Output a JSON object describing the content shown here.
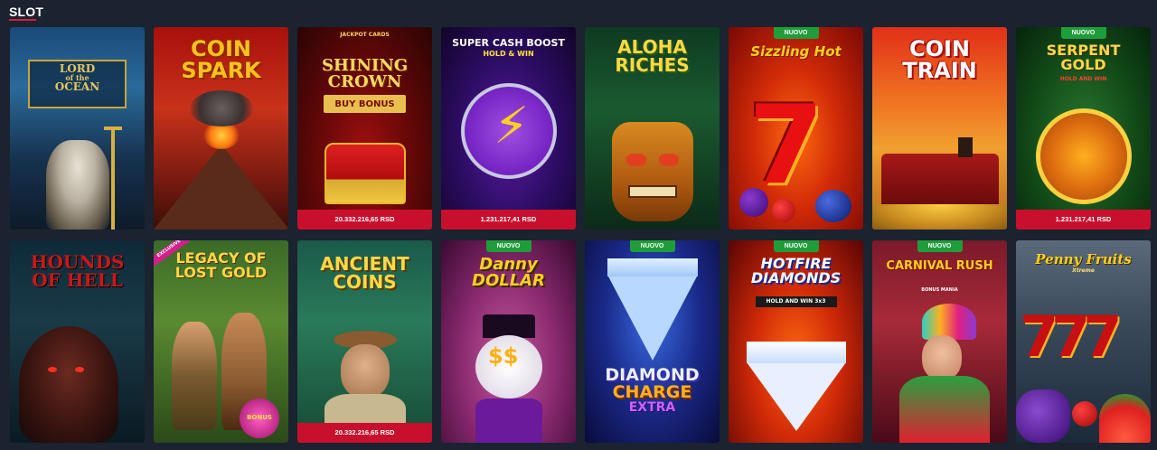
{
  "section": {
    "title": "SLOT"
  },
  "games": [
    {
      "name_lines": [
        "LORD",
        "of the",
        "OCEAN"
      ],
      "badge": "",
      "jackpot": ""
    },
    {
      "name_lines": [
        "COIN",
        "SPARK"
      ],
      "badge": "",
      "jackpot": ""
    },
    {
      "name_lines": [
        "SHINING",
        "CROWN"
      ],
      "small_top": "JACKPOT CARDS",
      "sub": "BUY BONUS",
      "badge": "",
      "jackpot": "20.332.216,65 RSD"
    },
    {
      "name_lines": [
        "SUPER CASH BOOST",
        "HOLD & WIN"
      ],
      "badge": "",
      "jackpot": "1.231.217,41 RSD"
    },
    {
      "name_lines": [
        "ALOHA",
        "RICHES"
      ],
      "badge": "",
      "jackpot": ""
    },
    {
      "name_lines": [
        "Sizzling Hot"
      ],
      "badge": "NUOVO",
      "jackpot": ""
    },
    {
      "name_lines": [
        "COIN",
        "TRAIN"
      ],
      "badge": "",
      "jackpot": ""
    },
    {
      "name_lines": [
        "SERPENT",
        "GOLD"
      ],
      "sub": "HOLD AND WIN",
      "badge": "NUOVO",
      "jackpot": "1.231.217,41 RSD"
    },
    {
      "name_lines": [
        "HOUNDS",
        "OF HELL"
      ],
      "badge": "",
      "jackpot": ""
    },
    {
      "name_lines": [
        "LEGACY OF",
        "LOST GOLD"
      ],
      "small_top": "EXCLUSIVE",
      "sub": "BONUS",
      "badge": "",
      "jackpot": ""
    },
    {
      "name_lines": [
        "ANCIENT",
        "COINS"
      ],
      "badge": "",
      "jackpot": "20.332.216,65 RSD"
    },
    {
      "name_lines": [
        "Danny",
        "DOLLAR"
      ],
      "badge": "NUOVO",
      "jackpot": ""
    },
    {
      "name_lines": [
        "DIAMOND",
        "CHARGE",
        "EXTRA"
      ],
      "badge": "NUOVO",
      "jackpot": ""
    },
    {
      "name_lines": [
        "HOTFIRE",
        "DIAMONDS"
      ],
      "sub": "HOLD AND WIN 3x3",
      "badge": "NUOVO",
      "jackpot": ""
    },
    {
      "name_lines": [
        "CARNIVAL RUSH"
      ],
      "sub": "BONUS MANIA",
      "badge": "NUOVO",
      "jackpot": ""
    },
    {
      "name_lines": [
        "Penny Fruits"
      ],
      "sub": "Xtreme",
      "badge": "",
      "jackpot": ""
    }
  ],
  "colors": {
    "background": "#1b2230",
    "accent": "#d81b3c",
    "jackpot_bar": "#c8102e",
    "new_badge": "#1f9d3a"
  }
}
